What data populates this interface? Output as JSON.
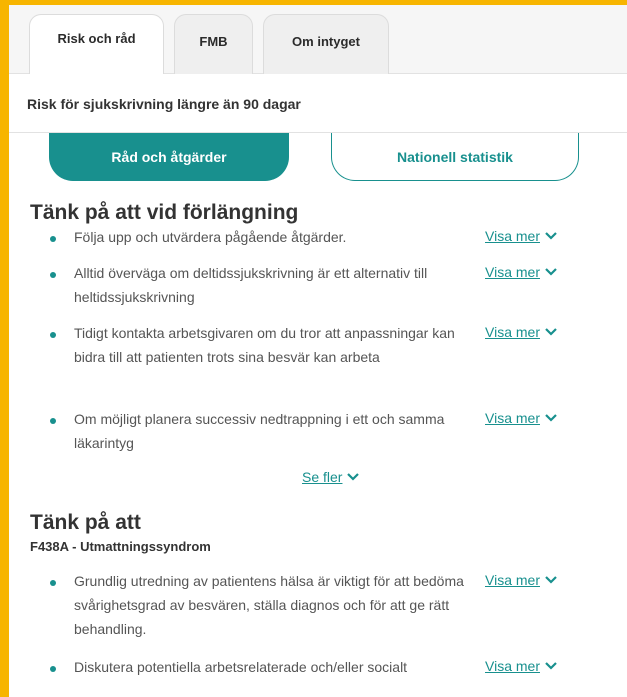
{
  "tabs": [
    {
      "label": "Risk och råd",
      "active": true
    },
    {
      "label": "FMB",
      "active": false
    },
    {
      "label": "Om intyget",
      "active": false
    }
  ],
  "subtitle": "Risk för sjukskrivning längre än 90 dagar",
  "buttons": {
    "primary": "Råd och åtgärder",
    "secondary": "Nationell statistik"
  },
  "section1": {
    "heading": "Tänk på att vid förlängning",
    "items": [
      {
        "text": "Följa upp och utvärdera pågående åtgärder.",
        "link": "Visa mer"
      },
      {
        "text": "Alltid överväga om deltidssjukskrivning är ett alternativ till heltidssjukskrivning",
        "link": "Visa mer"
      },
      {
        "text": "Tidigt kontakta arbetsgivaren om du tror att anpassningar kan bidra till att patienten trots sina besvär kan arbeta",
        "link": "Visa mer"
      },
      {
        "text": "Om möjligt planera successiv nedtrappning i ett och samma läkarintyg",
        "link": "Visa mer"
      }
    ],
    "more": "Se fler"
  },
  "section2": {
    "heading": "Tänk på att",
    "diagnosis": "F438A - Utmattningssyndrom",
    "items": [
      {
        "text": "Grundlig utredning av patientens hälsa är viktigt för att bedöma svårighetsgrad av besvären, ställa diagnos och för att ge rätt behandling.",
        "link": "Visa mer"
      },
      {
        "text": "Diskutera potentiella arbetsrelaterade och/eller socialt",
        "link": "Visa mer"
      }
    ]
  },
  "colors": {
    "accent": "#18908e",
    "frame": "#f7b500"
  },
  "icons": {
    "expand": "chevron-down-icon"
  }
}
